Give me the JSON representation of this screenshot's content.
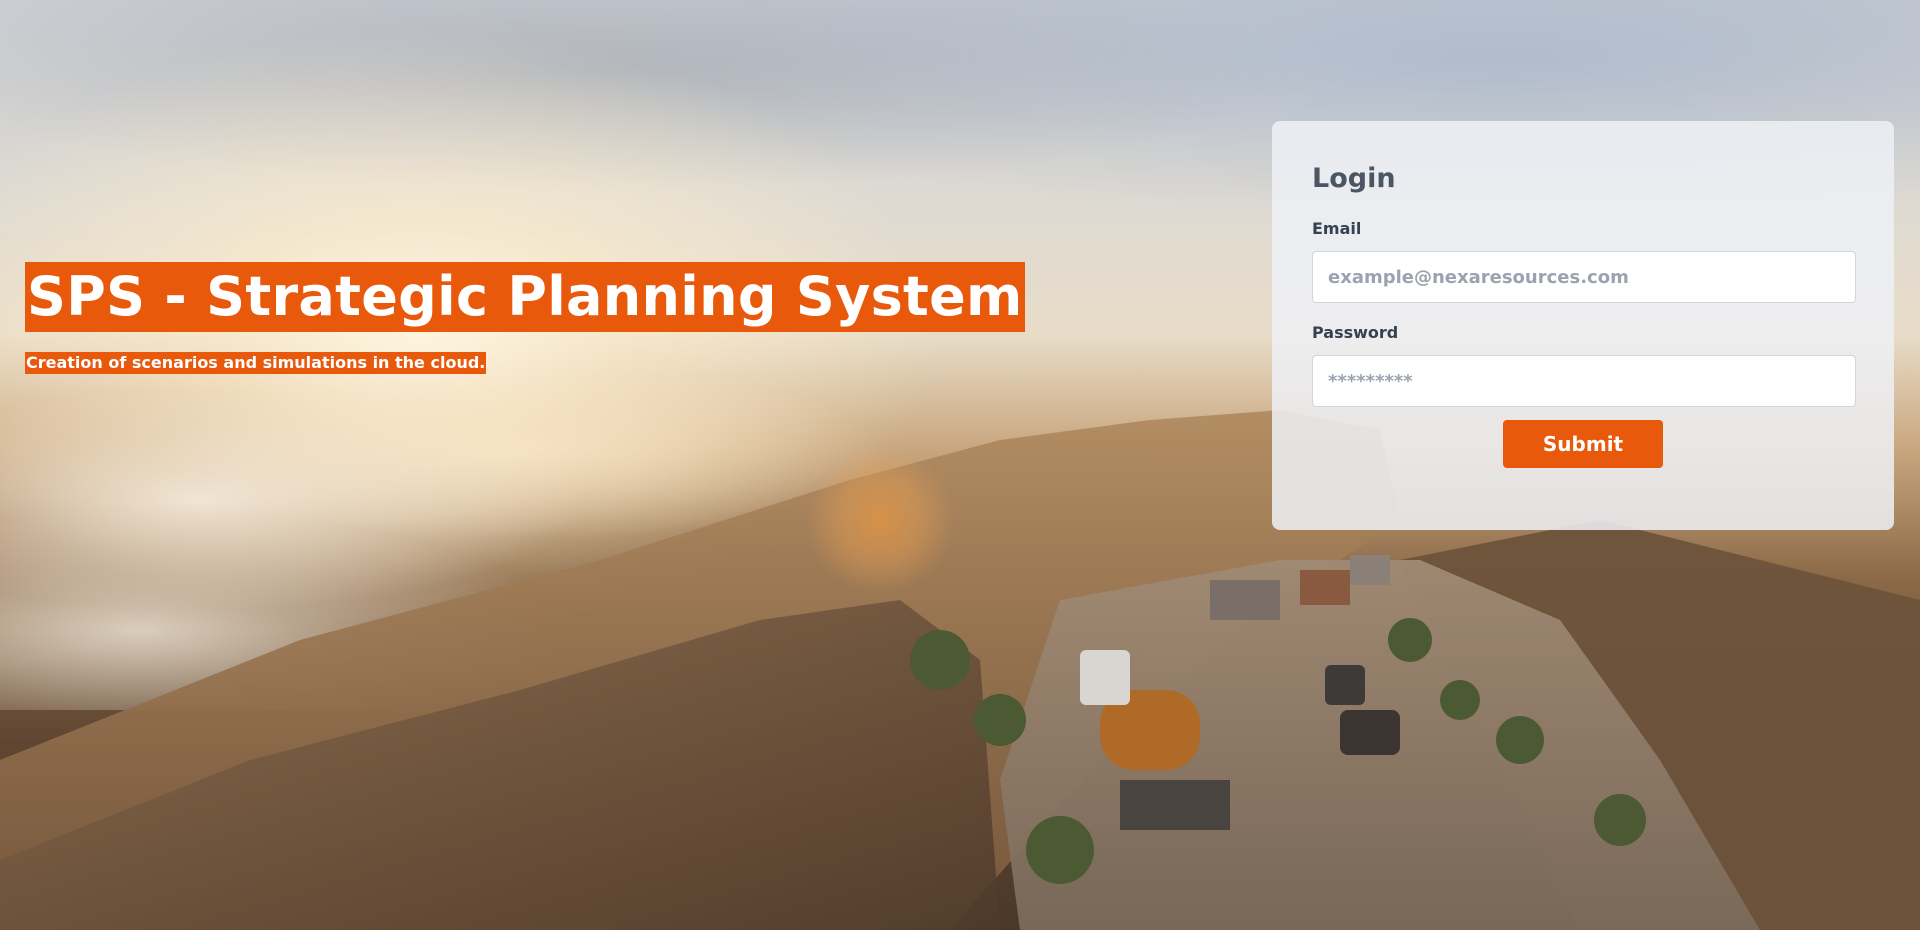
{
  "hero": {
    "title": "SPS - Strategic Planning System",
    "subtitle": "Creation of scenarios and simulations in the cloud."
  },
  "login": {
    "heading": "Login",
    "email_label": "Email",
    "email_placeholder": "example@nexaresources.com",
    "password_label": "Password",
    "password_placeholder": "*********",
    "submit_label": "Submit"
  },
  "colors": {
    "accent": "#e8590c",
    "card_background": "#eef0f4",
    "heading_text": "#4b5563"
  },
  "background": {
    "image_subject": "mountain-road-with-tanker-trucks-at-sunrise"
  }
}
